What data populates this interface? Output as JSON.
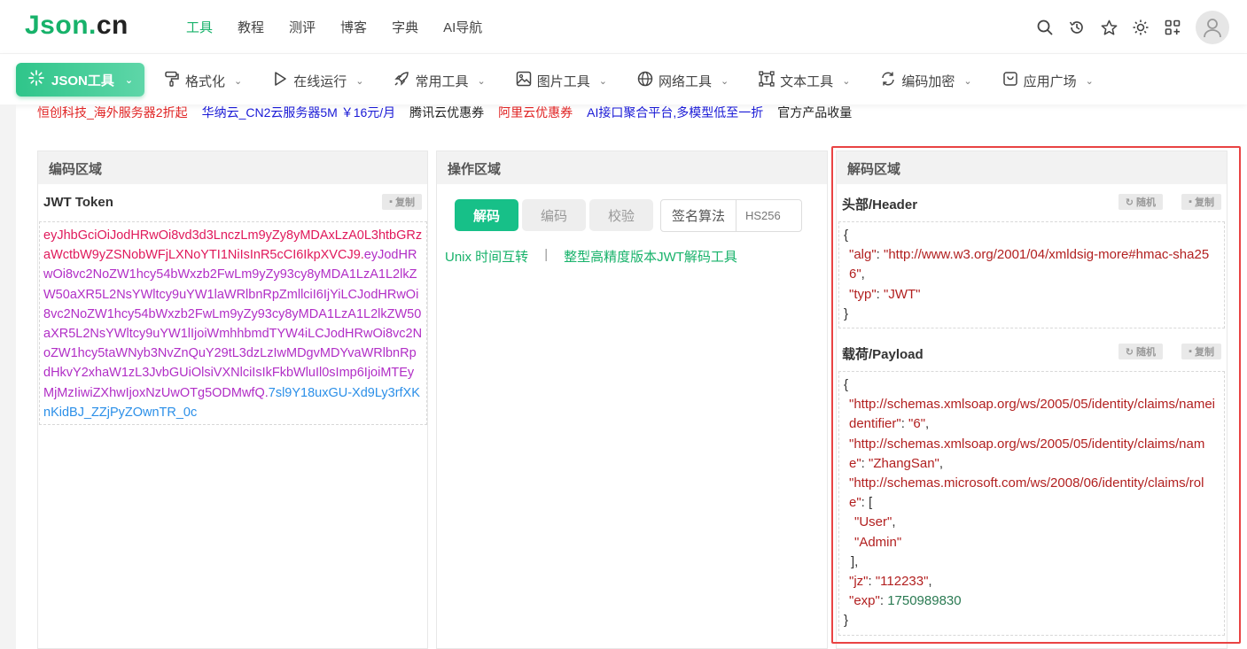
{
  "header": {
    "logo_main": "Json",
    "logo_dot": ".",
    "logo_cn": "cn",
    "nav": [
      {
        "label": "工具",
        "active": true
      },
      {
        "label": "教程",
        "active": false
      },
      {
        "label": "测评",
        "active": false
      },
      {
        "label": "博客",
        "active": false
      },
      {
        "label": "字典",
        "active": false
      },
      {
        "label": "AI导航",
        "active": false
      }
    ],
    "icons": [
      "search-icon",
      "history-icon",
      "star-icon",
      "theme-sun-icon",
      "apps-grid-icon",
      "user-avatar-icon"
    ]
  },
  "toolbar": {
    "json_tool_label": "JSON工具",
    "items": [
      {
        "label": "格式化",
        "icon": "paint-roller-icon"
      },
      {
        "label": "在线运行",
        "icon": "play-icon"
      },
      {
        "label": "常用工具",
        "icon": "rocket-icon"
      },
      {
        "label": "图片工具",
        "icon": "image-icon"
      },
      {
        "label": "网络工具",
        "icon": "globe-icon"
      },
      {
        "label": "文本工具",
        "icon": "text-frame-icon"
      },
      {
        "label": "编码加密",
        "icon": "code-refresh-icon"
      },
      {
        "label": "应用广场",
        "icon": "bag-icon"
      }
    ]
  },
  "ads": [
    {
      "text": "恒创科技_海外服务器2折起",
      "color": "#e02424"
    },
    {
      "text": "华纳云_CN2云服务器5M ￥16元/月",
      "color": "#1a1ad6"
    },
    {
      "text": "腾讯云优惠券",
      "color": "#222222"
    },
    {
      "text": "阿里云优惠券",
      "color": "#e02424"
    },
    {
      "text": "AI接口聚合平台,多模型低至一折",
      "color": "#1a1ad6"
    },
    {
      "text": "官方产品收量",
      "color": "#222222"
    }
  ],
  "encode_panel": {
    "title": "编码区域",
    "subtitle": "JWT Token",
    "copy_label": "复制",
    "token_header": "eyJhbGciOiJodHRwOi8vd3d3LnczLm9yZy8yMDAxLzA0L3htbGRzaWctbW9yZSNobWFjLXNoYTI1NiIsInR5cCI6IkpXVCJ9.",
    "token_payload": "eyJodHRwOi8vc2NoZW1hcy54bWxzb2FwLm9yZy93cy8yMDA1LzA1L2lkZW50aXR5L2NsYWltcy9uYW1laWRlbnRpZmllciI6IjYiLCJodHRwOi8vc2NoZW1hcy54bWxzb2FwLm9yZy93cy8yMDA1LzA1L2lkZW50aXR5L2NsYWltcy9uYW1lIjoiWmhhbmdTYW4iLCJodHRwOi8vc2NoZW1hcy5taWNyb3NvZnQuY29tL3dzLzIwMDgvMDYvaWRlbnRpdHkvY2xhaW1zL3JvbGUiOlsiVXNlciIsIkFkbWluIl0sImp6IjoiMTEyMjMzIiwiZXhwIjoxNzUwOTg5ODMwfQ.",
    "token_signature": "7sl9Y18uxGU-Xd9Ly3rfXKnKidBJ_ZZjPyZOwnTR_0c"
  },
  "operation_panel": {
    "title": "操作区域",
    "decode_btn": "解码",
    "encode_btn": "编码",
    "verify_btn": "校验",
    "algo_label": "签名算法",
    "algo_value": "HS256",
    "link_unix": "Unix 时间互转",
    "link_sep": "|",
    "link_hp": "整型高精度版本JWT解码工具"
  },
  "decode_panel": {
    "title": "解码区域",
    "header_title": "头部/Header",
    "payload_title": "载荷/Payload",
    "random_label": "随机",
    "copy_label": "复制",
    "header_lines": [
      {
        "t": "brace",
        "text": "{"
      },
      {
        "t": "kv",
        "key": "\"alg\"",
        "val": "\"http://www.w3.org/2001/04/xmldsig-more#hmac-sha256\"",
        "vt": "s",
        "comma": ","
      },
      {
        "t": "kv",
        "key": "\"typ\"",
        "val": "\"JWT\"",
        "vt": "s",
        "comma": ""
      },
      {
        "t": "brace",
        "text": "}"
      }
    ],
    "payload_lines": [
      {
        "t": "brace",
        "text": "{"
      },
      {
        "t": "kv",
        "key": "\"http://schemas.xmlsoap.org/ws/2005/05/identity/claims/nameidentifier\"",
        "val": "\"6\"",
        "vt": "s",
        "comma": ","
      },
      {
        "t": "kv",
        "key": "\"http://schemas.xmlsoap.org/ws/2005/05/identity/claims/name\"",
        "val": "\"ZhangSan\"",
        "vt": "s",
        "comma": ","
      },
      {
        "t": "kv",
        "key": "\"http://schemas.microsoft.com/ws/2008/06/identity/claims/role\"",
        "val": "[",
        "vt": "p",
        "comma": ""
      },
      {
        "t": "item",
        "val": "\"User\"",
        "comma": ","
      },
      {
        "t": "item",
        "val": "\"Admin\"",
        "comma": ""
      },
      {
        "t": "close",
        "text": "],"
      },
      {
        "t": "kv",
        "key": "\"jz\"",
        "val": "\"112233\"",
        "vt": "s",
        "comma": ","
      },
      {
        "t": "kv",
        "key": "\"exp\"",
        "val": "1750989830",
        "vt": "n",
        "comma": ""
      },
      {
        "t": "brace",
        "text": "}"
      }
    ]
  }
}
